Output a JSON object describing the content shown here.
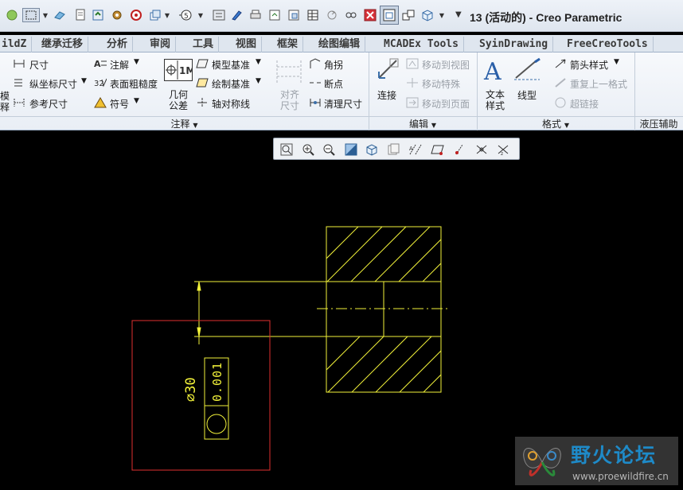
{
  "window": {
    "title": "13 (活动的) - Creo Parametric"
  },
  "tabs": [
    {
      "label": "ildZ"
    },
    {
      "label": "继承迁移"
    },
    {
      "label": "分析"
    },
    {
      "label": "审阅"
    },
    {
      "label": "工具"
    },
    {
      "label": "视图"
    },
    {
      "label": "框架"
    },
    {
      "label": "绘图编辑"
    },
    {
      "label": "MCADEx Tools"
    },
    {
      "label": "SyinDrawing"
    },
    {
      "label": "FreeCreoTools"
    }
  ],
  "ribbon": {
    "annotation": {
      "cut_label_1": "模",
      "cut_label_2": "释",
      "dimension": "尺寸",
      "ordinate_dimension": "纵坐标尺寸",
      "reference_dimension": "参考尺寸",
      "note": "注解",
      "surface_finish": "表面粗糙度",
      "symbol": "符号",
      "geometric_tolerance_1": "几何",
      "geometric_tolerance_2": "公差",
      "model_datum": "模型基准",
      "draw_datum": "绘制基准",
      "axis_symmetry": "轴对称线",
      "align_1": "对齐",
      "align_2": "尺寸",
      "corner": "角拐",
      "breakpoint": "断点",
      "cleanup_dimension": "清理尺寸",
      "group_label": "注释"
    },
    "edit": {
      "connect": "连接",
      "move_to_view": "移动到视图",
      "move_special": "移动特殊",
      "move_to_page": "移动到页面",
      "group_label": "编辑"
    },
    "format": {
      "text_style_1": "文本",
      "text_style_2": "样式",
      "line_style": "线型",
      "arrow_style": "箭头样式",
      "repeat_format": "重复上一格式",
      "hyperlink": "超链接",
      "group_label": "格式"
    },
    "hydraulic": {
      "group_label": "液压辅助"
    }
  },
  "drawing": {
    "dimension_text": "∅30",
    "tolerance_text": "0.001"
  },
  "watermark": {
    "title": "野火论坛",
    "url": "www.proewildfire.cn"
  },
  "colors": {
    "canvas_bg": "#000000",
    "drawing_lines": "#f2f23a",
    "selection_box": "#e03030"
  }
}
